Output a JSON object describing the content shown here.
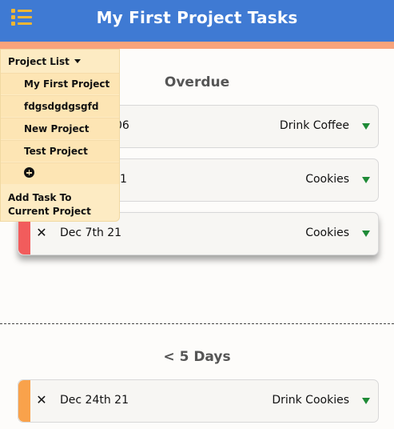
{
  "header": {
    "title": "My First Project Tasks",
    "menu_icon": "hamburger-list-icon",
    "bg_color": "#3f7ad3",
    "strip_color": "#f8a37b",
    "icon_color": "#f2b632"
  },
  "sections": [
    {
      "title": "Overdue",
      "tasks": [
        {
          "remove": "✕",
          "date": "06",
          "name": "Drink Coffee",
          "stripe_color": ""
        },
        {
          "remove": "✕",
          "date": "1",
          "name": "Cookies",
          "stripe_color": ""
        },
        {
          "remove": "✕",
          "date": "Dec 7th 21",
          "name": "Cookies",
          "stripe_color": "#f25c5c"
        }
      ]
    },
    {
      "title": "< 5 Days",
      "tasks": [
        {
          "remove": "✕",
          "date": "Dec 24th 21",
          "name": "Drink Cookies",
          "stripe_color": "#f9a24b"
        }
      ]
    }
  ],
  "project_menu": {
    "header": "Project List",
    "projects": [
      "My First Project",
      "fdgsdgdgsgfd",
      "New Project",
      "Test Project"
    ],
    "add_project_icon": "plus-circle-icon",
    "add_task_label": "Add Task To Current Project"
  },
  "colors": {
    "expand_caret": "#1e8a36",
    "menu_bg": "#fde5b4"
  }
}
